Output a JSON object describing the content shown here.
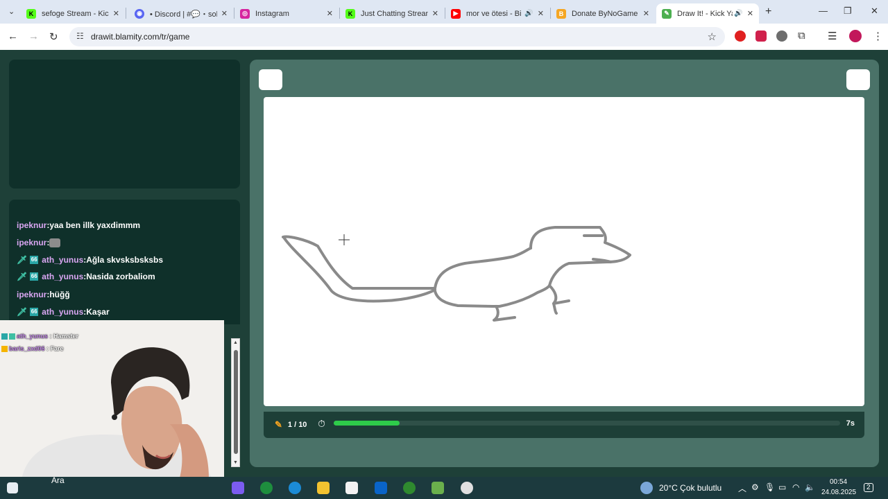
{
  "browser": {
    "tabs": [
      {
        "title": "sefoge Stream - Kick",
        "favicon": "kick-icon",
        "color": "#53fc18"
      },
      {
        "title": "• Discord | #💬・sohbet",
        "favicon": "discord-icon",
        "color": "#5865f2"
      },
      {
        "title": "Instagram",
        "favicon": "instagram-icon",
        "color": "#d6249f"
      },
      {
        "title": "Just Chatting Stream",
        "favicon": "kick-icon",
        "color": "#53fc18"
      },
      {
        "title": "mor ve ötesi - Bir",
        "favicon": "youtube-icon",
        "color": "#ff0000"
      },
      {
        "title": "Donate ByNoGame",
        "favicon": "bynogame-icon",
        "color": "#f5a623"
      },
      {
        "title": "Draw It! - Kick Ya",
        "favicon": "drawit-icon",
        "color": "#4caf50"
      }
    ],
    "url": "drawit.blamity.com/tr/game"
  },
  "chat": {
    "messages": [
      {
        "user": "ipeknur",
        "text": "yaa ben illk yaxdimmm",
        "badges": false
      },
      {
        "user": "ipeknur",
        "text": "",
        "emote": "cat-emote",
        "badges": false
      },
      {
        "user": "ath_yunus",
        "text": "Ağla skvsksbsksbs",
        "badges": true
      },
      {
        "user": "ath_yunus",
        "text": "Nasida zorbaliom",
        "badges": true
      },
      {
        "user": "ipeknur",
        "text": "hüğğ",
        "badges": false
      },
      {
        "user": "ath_yunus",
        "text": "Kaşar",
        "badges": true
      }
    ]
  },
  "overlay_chat": [
    {
      "user": "ath_yunus",
      "text": "Hamster"
    },
    {
      "user": "baris_zxd06",
      "text": "Fare"
    }
  ],
  "game": {
    "round": "1 / 10",
    "timer": "7s",
    "timer_progress": 0.13
  },
  "taskbar": {
    "search": "Ara",
    "weather": "20°C  Çok bulutlu",
    "time": "00:54",
    "date": "24.08.2025",
    "notifications": "2"
  }
}
